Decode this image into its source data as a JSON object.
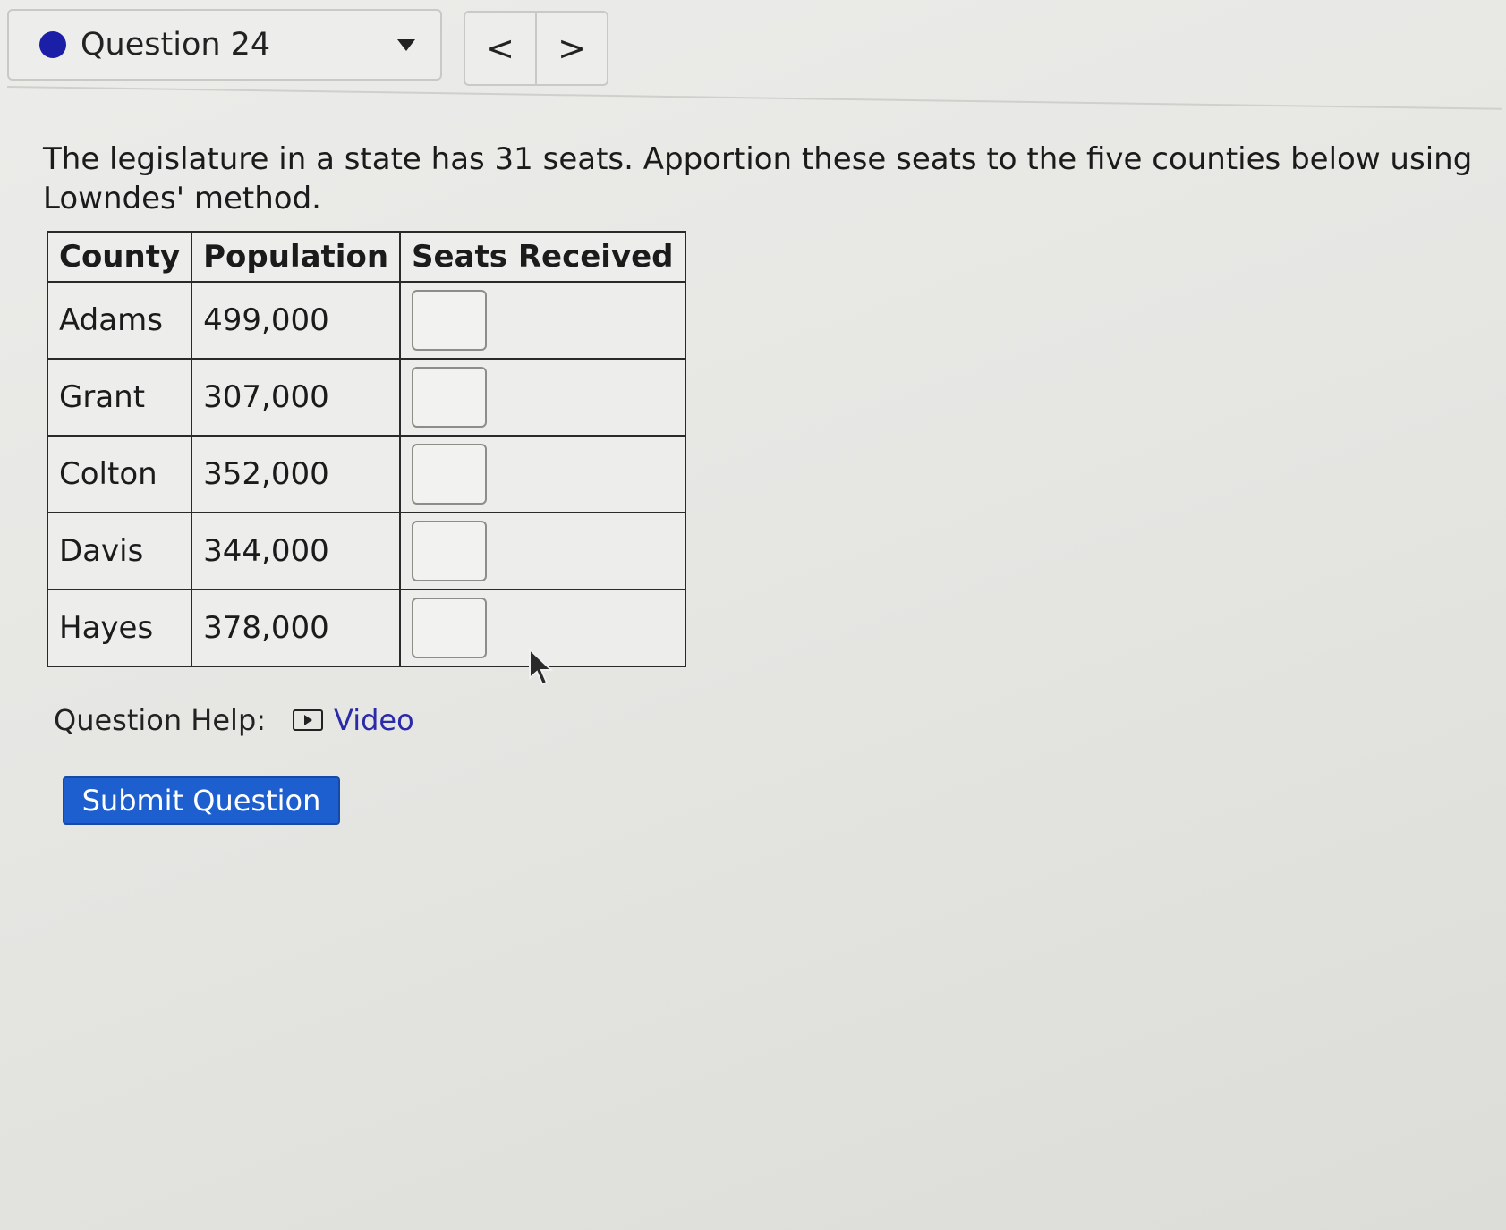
{
  "header": {
    "question_label": "Question 24",
    "status_color": "#1b1fa8",
    "dropdown_icon": "caret-down-icon",
    "prev_label": "<",
    "next_label": ">"
  },
  "prompt": {
    "text": "The legislature in a state has 31 seats.  Apportion these seats to the five counties below using Lowndes' method."
  },
  "table": {
    "headers": [
      "County",
      "Population",
      "Seats Received"
    ],
    "rows": [
      {
        "county": "Adams",
        "population": "499,000",
        "seats": ""
      },
      {
        "county": "Grant",
        "population": "307,000",
        "seats": ""
      },
      {
        "county": "Colton",
        "population": "352,000",
        "seats": ""
      },
      {
        "county": "Davis",
        "population": "344,000",
        "seats": ""
      },
      {
        "county": "Hayes",
        "population": "378,000",
        "seats": ""
      }
    ]
  },
  "help": {
    "label": "Question Help:",
    "video_label": "Video",
    "video_icon": "play-box-icon",
    "link_color": "#2b2aa8"
  },
  "actions": {
    "submit_label": "Submit Question",
    "submit_color": "#1e5fd0"
  }
}
